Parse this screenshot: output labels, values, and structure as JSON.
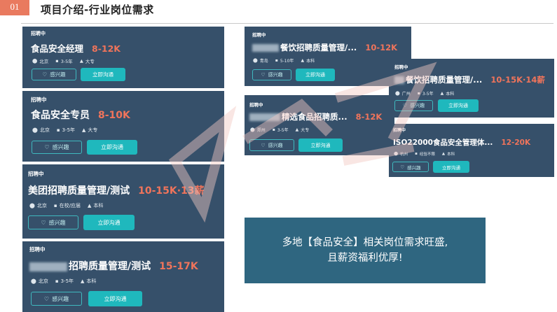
{
  "header": {
    "badge": "01",
    "title": "项目介绍-行业岗位需求"
  },
  "common": {
    "status": "招聘中",
    "like": "感兴趣",
    "chat": "立即沟通"
  },
  "cards": [
    {
      "title": "食品安全经理",
      "salary": "8-12K",
      "city": "北京",
      "exp": "3-5年",
      "edu": "大专"
    },
    {
      "title": "食品安全专员",
      "salary": "8-10K",
      "city": "北京",
      "exp": "3-5年",
      "edu": "大专"
    },
    {
      "title": "美团招聘质量管理/测试",
      "salary": "10-15K·13薪",
      "city": "北京",
      "exp": "在校/应届",
      "edu": "本科"
    },
    {
      "title": "招聘质量管理/测试",
      "salary": "15-17K",
      "city": "北京",
      "exp": "3-5年",
      "edu": "本科"
    },
    {
      "title": "餐饮招聘质量管理/...",
      "salary": "10-12K",
      "city": "青岛",
      "exp": "5-10年",
      "edu": "本科"
    },
    {
      "title": "餐饮招聘质量管理/...",
      "salary": "10-15K·14薪",
      "city": "广州",
      "exp": "3-5年",
      "edu": "本科"
    },
    {
      "title": "精选食品招聘质...",
      "salary": "8-12K",
      "city": "郑州",
      "exp": "3-5年",
      "edu": "大专"
    },
    {
      "title": "ISO22000食品安全管理体...",
      "salary": "12-20K",
      "city": "杭州",
      "exp": "经验不限",
      "edu": "本科"
    }
  ],
  "callout": {
    "line1": "多地【食品安全】相关岗位需求旺盛,",
    "line2": "且薪资福利优厚!"
  },
  "colors": {
    "card_bg": "#36506a",
    "salary": "#f0745b",
    "chat_btn": "#1fb8bd",
    "callout_bg": "#2f6680",
    "badge": "#e97a5f"
  }
}
